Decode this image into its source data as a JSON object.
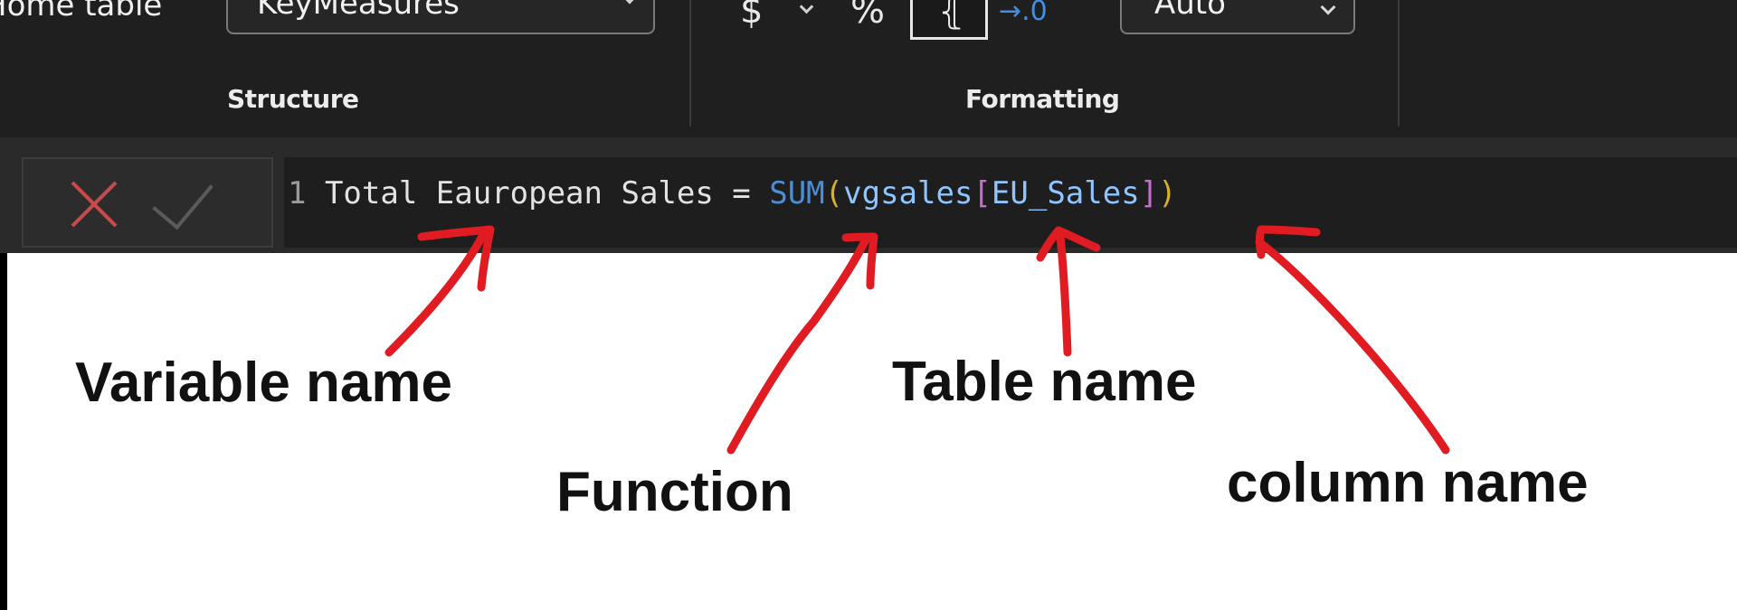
{
  "ribbon": {
    "home_table_label": "Home table",
    "home_table_value": "KeyMeasures",
    "format_currency": "$",
    "format_percent": "%",
    "format_comma": "⦃",
    "format_decimal": "→.0",
    "auto_value": "Auto",
    "groups": {
      "structure": "Structure",
      "formatting": "Formatting"
    }
  },
  "formula": {
    "line_number": "1",
    "measure_text": " Total Eauropean Sales = ",
    "function": "SUM",
    "open_paren": "(",
    "table": "vgsales",
    "open_bracket": "[",
    "column": "EU_Sales",
    "close_bracket": "]",
    "close_paren": ")"
  },
  "annotations": {
    "variable": "Variable name",
    "table": "Table name",
    "function": "Function",
    "column": "column name"
  },
  "colors": {
    "arrow": "#e11b22",
    "function_token": "#4b8ed8",
    "paren_token": "#d6b02a",
    "bracket_token": "#c76ad1",
    "cancel": "#c94a4a"
  }
}
